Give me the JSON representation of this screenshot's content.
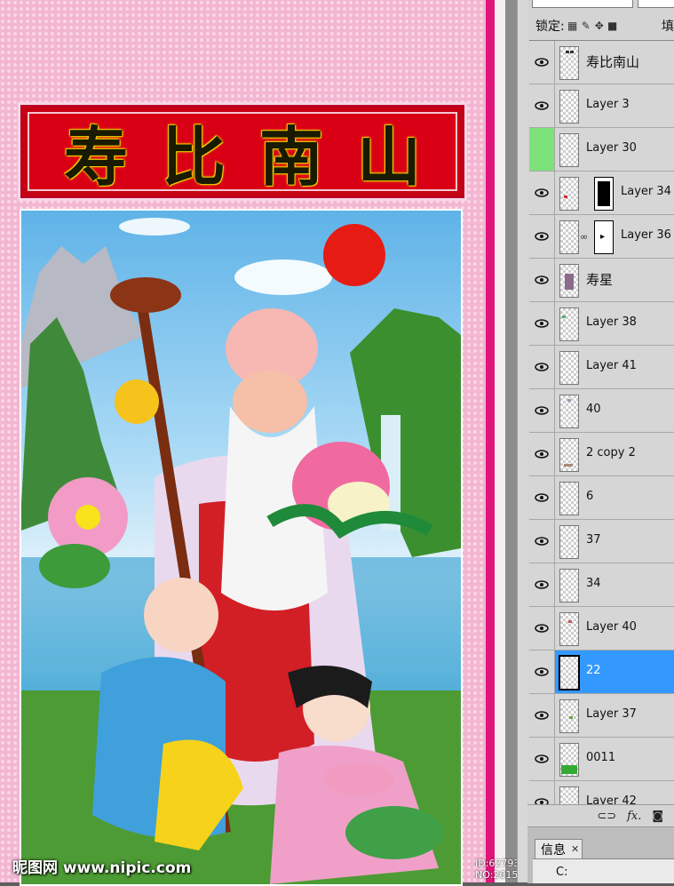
{
  "poster": {
    "title": "寿比南山",
    "watermark_left": "昵图网 www.nipic.com",
    "watermark_right": "ID:627931 NO:20150614071452182054"
  },
  "panel": {
    "lock_label": "锁定:",
    "fill_label": "填",
    "layers": [
      {
        "name": "寿比南山",
        "visible": true
      },
      {
        "name": "Layer 3",
        "visible": true
      },
      {
        "name": "Layer 30",
        "visible": false
      },
      {
        "name": "Layer 34",
        "visible": true,
        "mask": true
      },
      {
        "name": "Layer 36",
        "visible": true,
        "mask": true,
        "linked": true
      },
      {
        "name": "寿星",
        "visible": true
      },
      {
        "name": "Layer 38",
        "visible": true
      },
      {
        "name": "Layer 41",
        "visible": true
      },
      {
        "name": "40",
        "visible": true
      },
      {
        "name": "2 copy 2",
        "visible": true
      },
      {
        "name": "6",
        "visible": true
      },
      {
        "name": "37",
        "visible": true
      },
      {
        "name": "34",
        "visible": true
      },
      {
        "name": "Layer 40",
        "visible": true
      },
      {
        "name": "22",
        "visible": true,
        "selected": true
      },
      {
        "name": "Layer 37",
        "visible": true
      },
      {
        "name": "0011",
        "visible": true
      },
      {
        "name": "Layer 42",
        "visible": true
      }
    ],
    "bottom_icons": [
      "link-icon",
      "fx-icon",
      "mask-icon"
    ],
    "info_tab": "信息",
    "info_c_label": "C:"
  },
  "colors": {
    "selection": "#3399ff",
    "poster_pink": "#f3b6d2",
    "banner_red": "#d90016"
  }
}
